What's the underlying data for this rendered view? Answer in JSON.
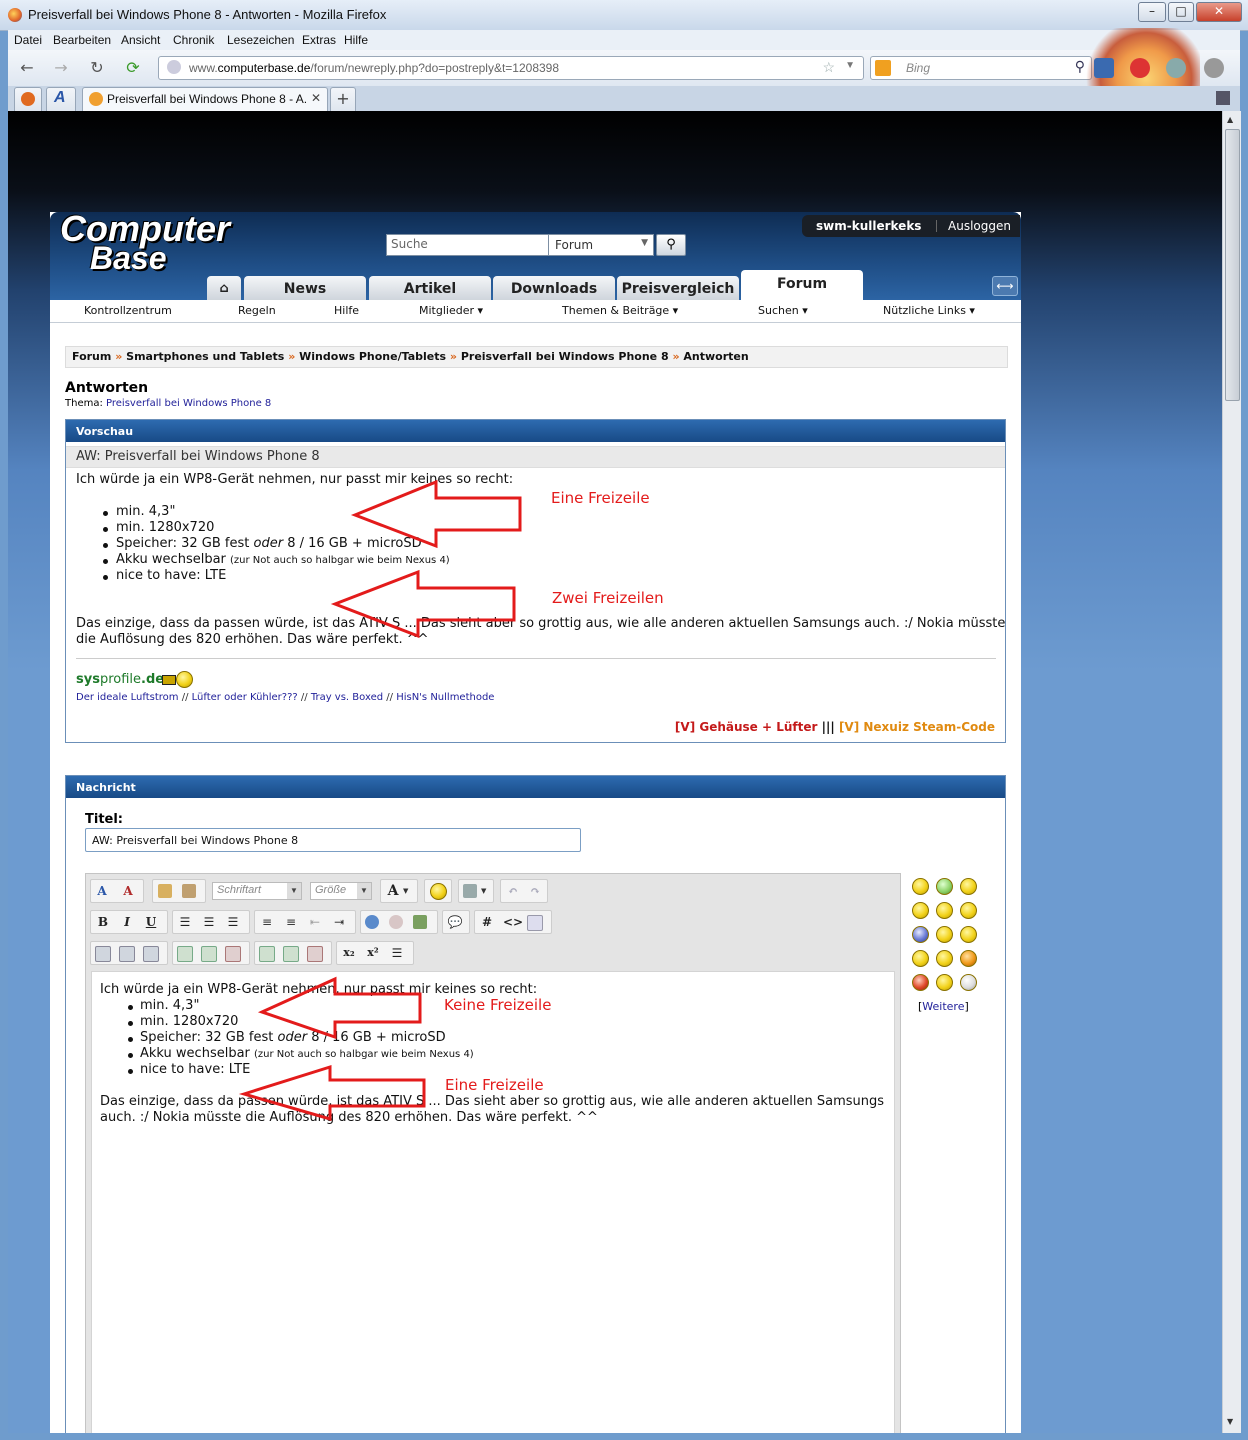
{
  "window": {
    "title": "Preisverfall bei Windows Phone 8 - Antworten - Mozilla Firefox",
    "controls": {
      "minimize": "–",
      "maximize": "□",
      "close": "✕"
    }
  },
  "menu": [
    "Datei",
    "Bearbeiten",
    "Ansicht",
    "Chronik",
    "Lesezeichen",
    "Extras",
    "Hilfe"
  ],
  "toolbar": {
    "back": "←",
    "forward": "→",
    "reload": "↻",
    "url_domain": "computerbase.de",
    "url_prefix": "www.",
    "url_path": "/forum/newreply.php?do=postreply&t=1208398",
    "search_placeholder": "Bing"
  },
  "tabs": {
    "active_title": "Preisverfall bei Windows Phone 8 - A...",
    "app_tab_2": "A",
    "new_tab": "+"
  },
  "site": {
    "logo_line1": "Computer",
    "logo_line2": "Base",
    "user": {
      "name": "swm-kullerkeks",
      "logout": "Ausloggen"
    },
    "search": {
      "placeholder": "Suche",
      "scope": "Forum"
    },
    "main_nav": [
      "News",
      "Artikel",
      "Downloads",
      "Preisvergleich",
      "Forum"
    ],
    "home_icon": "⌂",
    "sub_nav": [
      "Kontrollzentrum",
      "Regeln",
      "Hilfe",
      "Mitglieder ▾",
      "Themen & Beiträge ▾",
      "Suchen ▾",
      "Nützliche Links ▾"
    ]
  },
  "breadcrumb": [
    "Forum",
    "Smartphones und Tablets",
    "Windows Phone/Tablets",
    "Preisverfall bei Windows Phone 8",
    "Antworten"
  ],
  "breadcrumb_sep": "»",
  "page": {
    "heading": "Antworten",
    "thema_label": "Thema:",
    "thema_link": "Preisverfall bei Windows Phone 8"
  },
  "preview": {
    "header": "Vorschau",
    "subtitle": "AW: Preisverfall bei Windows Phone 8",
    "intro": "Ich würde ja ein WP8-Gerät nehmen, nur passt mir keines so recht:",
    "items": [
      "min. 4,3\"",
      "min. 1280x720",
      "Speicher: 32 GB fest ",
      "Akku wechselbar ",
      "nice to have: LTE"
    ],
    "item3_oder": "oder",
    "item3_rest": " 8 / 16 GB + microSD",
    "item4_small": "(zur Not auch so halbgar wie beim Nexus 4)",
    "body_line1": "Das einzige, dass da passen würde, ist das ATIV S ... Das sieht aber so grottig aus, wie alle anderen aktuellen Samsungs auch. :/ Nokia müsste",
    "body_line2": "die Auflösung des 820 erhöhen. Das wäre perfekt. ^^",
    "signature": {
      "sys": "sys",
      "profile": "profile",
      "de": ".de",
      "links": [
        "Der ideale Luftstrom",
        "Lüfter oder Kühler???",
        "Tray vs. Boxed",
        "HisN's Nullmethode"
      ],
      "link_sep": " // ",
      "right_1": "[V] Gehäuse + Lüfter",
      "right_sep": " ||| ",
      "right_2": "[V] Nexuiz Steam-Code"
    }
  },
  "message": {
    "header": "Nachricht",
    "title_label": "Titel:",
    "title_value": "AW: Preisverfall bei Windows Phone 8",
    "font_select": "Schriftart",
    "size_select": "Größe",
    "editor_intro": "Ich würde ja ein WP8-Gerät nehmen, nur passt mir keines so recht:",
    "editor_items": [
      "min. 4,3\"",
      "min. 1280x720",
      "Speicher: 32 GB fest ",
      "Akku wechselbar ",
      "nice to have: LTE"
    ],
    "editor_oder": "oder",
    "editor_item3_rest": " 8 / 16 GB + microSD",
    "editor_item4_small": "(zur Not auch so halbgar wie beim Nexus 4)",
    "editor_body_line1": "Das einzige, dass da passen würde, ist das ATIV S ... Das sieht aber so grottig aus, wie alle anderen aktuellen Samsungs",
    "editor_body_line2": "auch. :/ Nokia müsste die Auflösung des 820 erhöhen. Das wäre perfekt. ^^",
    "smilies_more": "Weitere"
  },
  "annotations": [
    "Eine Freizeile",
    "Zwei Freizeilen",
    "Keine Freizeile",
    "Eine Freizeile"
  ],
  "colors": {
    "annotation": "#e31b1b",
    "header_blue": "#184a86",
    "link": "#22229a",
    "sig_green": "#1e7a2a",
    "sig_red": "#c41a1a",
    "sig_orange": "#e08a10"
  }
}
